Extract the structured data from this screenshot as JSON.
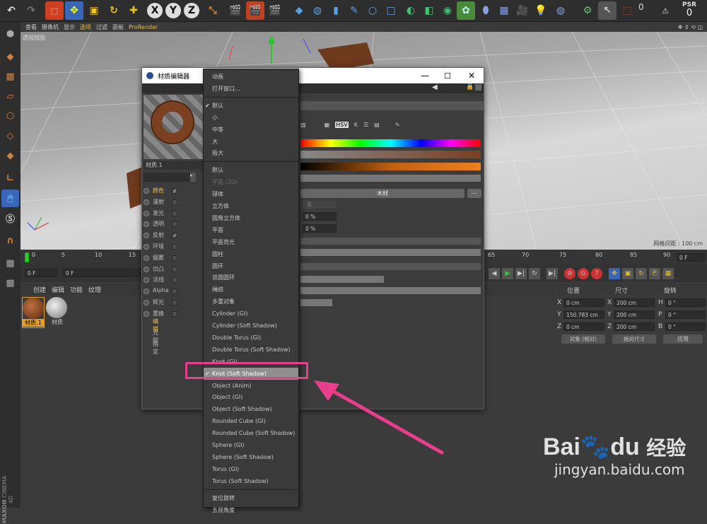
{
  "viewport_menu": [
    "查看",
    "摄像机",
    "显示",
    "选项",
    "过滤",
    "面板",
    "ProRender"
  ],
  "viewport_label": "透视视图",
  "grid_spacing": "网格间距 : 100 cm",
  "timeline_ticks": [
    "0",
    "5",
    "10",
    "15",
    "65",
    "70",
    "75",
    "80",
    "85",
    "90"
  ],
  "frame_field": "0 F",
  "transport": {
    "start_field": "0 F",
    "pos_field": "0 F",
    "end_field": "0 F"
  },
  "matmgr_menu": [
    "创建",
    "编辑",
    "功能",
    "纹理"
  ],
  "materials": [
    "材质.1",
    "材质"
  ],
  "coords": {
    "headers": [
      "位置",
      "尺寸",
      "旋转"
    ],
    "rows": [
      {
        "axis": "X",
        "pos": "0 cm",
        "size_axis": "X",
        "size": "200 cm",
        "rot_axis": "H",
        "rot": "0 °"
      },
      {
        "axis": "Y",
        "pos": "150.783 cm",
        "size_axis": "Y",
        "size": "200 cm",
        "rot_axis": "P",
        "rot": "0 °"
      },
      {
        "axis": "Z",
        "pos": "0 cm",
        "size_axis": "Z",
        "size": "200 cm",
        "rot_axis": "B",
        "rot": "0 °"
      }
    ],
    "mode_select": "对象 (相对)",
    "size_select": "绝对尺寸",
    "apply": "应用"
  },
  "dialog": {
    "title": "材质编辑器",
    "material_name": "材质.1",
    "channels": [
      {
        "name": "颜色",
        "checked": true,
        "active": true
      },
      {
        "name": "漫射",
        "checked": false,
        "active": false
      },
      {
        "name": "发光",
        "checked": false,
        "active": false
      },
      {
        "name": "透明",
        "checked": false,
        "active": false
      },
      {
        "name": "反射",
        "checked": true,
        "active": false
      },
      {
        "name": "环境",
        "checked": false,
        "active": false
      },
      {
        "name": "烟雾",
        "checked": false,
        "active": false
      },
      {
        "name": "凹凸",
        "checked": false,
        "active": false
      },
      {
        "name": "法线",
        "checked": false,
        "active": false
      },
      {
        "name": "Alpha",
        "checked": false,
        "active": false
      },
      {
        "name": "辉光",
        "checked": false,
        "active": false
      },
      {
        "name": "置换",
        "checked": false,
        "active": false
      }
    ],
    "extra": [
      "编辑",
      "光照",
      "指定"
    ],
    "texture_button": "木材",
    "pct1": "0 %",
    "pct2": "0 %",
    "none_select": "无"
  },
  "menu_items": [
    {
      "label": "动画",
      "checked": false,
      "disabled": false
    },
    {
      "label": "打开窗口...",
      "checked": false,
      "disabled": false
    },
    {
      "sep": true
    },
    {
      "label": "默认",
      "checked": true,
      "disabled": false
    },
    {
      "label": "小",
      "checked": false,
      "disabled": false
    },
    {
      "label": "中等",
      "checked": false,
      "disabled": false
    },
    {
      "label": "大",
      "checked": false,
      "disabled": false
    },
    {
      "label": "极大",
      "checked": false,
      "disabled": false
    },
    {
      "sep": true
    },
    {
      "label": "默认",
      "checked": false,
      "disabled": false
    },
    {
      "label": "平面 (2D)",
      "checked": false,
      "disabled": true
    },
    {
      "label": "球体",
      "checked": false,
      "disabled": false
    },
    {
      "label": "立方体",
      "checked": false,
      "disabled": false
    },
    {
      "label": "圆角立方体",
      "checked": false,
      "disabled": false
    },
    {
      "label": "平面",
      "checked": false,
      "disabled": false
    },
    {
      "label": "平面背光",
      "checked": false,
      "disabled": false
    },
    {
      "label": "圆柱",
      "checked": false,
      "disabled": false
    },
    {
      "label": "圆环",
      "checked": false,
      "disabled": false
    },
    {
      "label": "双圆圆环",
      "checked": false,
      "disabled": false
    },
    {
      "label": "绳结",
      "checked": false,
      "disabled": false
    },
    {
      "label": "多重对象",
      "checked": false,
      "disabled": false
    },
    {
      "label": "Cylinder (GI)",
      "checked": false,
      "disabled": false
    },
    {
      "label": "Cylinder (Soft Shadow)",
      "checked": false,
      "disabled": false
    },
    {
      "label": "Double Torus (GI)",
      "checked": false,
      "disabled": false
    },
    {
      "label": "Double Torus (Soft Shadow)",
      "checked": false,
      "disabled": false
    },
    {
      "label": "Knot (GI)",
      "checked": false,
      "disabled": false
    },
    {
      "label": "Knot (Soft Shadow)",
      "checked": true,
      "disabled": false,
      "selected": true
    },
    {
      "label": "Object (Anim)",
      "checked": false,
      "disabled": false
    },
    {
      "label": "Object (GI)",
      "checked": false,
      "disabled": false
    },
    {
      "label": "Object (Soft Shadow)",
      "checked": false,
      "disabled": false
    },
    {
      "label": "Rounded Cube (GI)",
      "checked": false,
      "disabled": false
    },
    {
      "label": "Rounded Cube (Soft Shadow)",
      "checked": false,
      "disabled": false
    },
    {
      "label": "Sphere (GI)",
      "checked": false,
      "disabled": false
    },
    {
      "label": "Sphere (Soft Shadow)",
      "checked": false,
      "disabled": false
    },
    {
      "label": "Torus (GI)",
      "checked": false,
      "disabled": false
    },
    {
      "label": "Torus (Soft Shadow)",
      "checked": false,
      "disabled": false
    },
    {
      "sep": true
    },
    {
      "label": "复位旋转",
      "checked": false,
      "disabled": false
    },
    {
      "label": "五视角度",
      "checked": false,
      "disabled": false
    }
  ],
  "watermark": {
    "brand": "Bai",
    "brand2": "du",
    "cn": "经验",
    "url": "jingyan.baidu.com"
  },
  "cinema": {
    "maxon": "MAXON",
    "c4d": "CINEMA 4D"
  },
  "psr": {
    "label": "PSR",
    "value": "0",
    "l0": "0"
  },
  "colors": {
    "accent": "#e83e8c",
    "orange": "#e88a1a",
    "wood": "#6e3a1e"
  }
}
